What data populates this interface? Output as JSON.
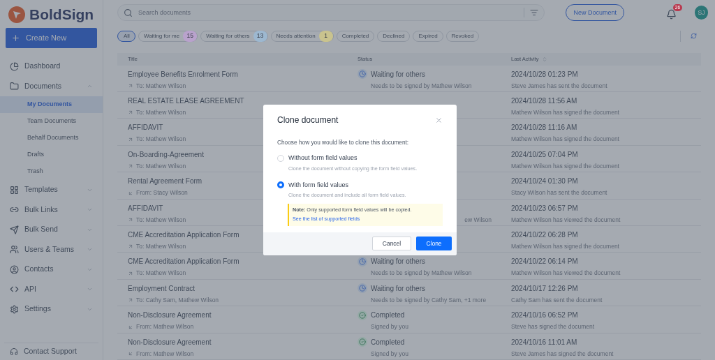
{
  "logo": {
    "text": "BoldSign"
  },
  "create_button": {
    "label": "Create New"
  },
  "sidebar": {
    "items": [
      {
        "label": "Dashboard",
        "has_caret": false,
        "selected": false
      },
      {
        "label": "Documents",
        "expanded": true,
        "has_caret": true,
        "selected": false,
        "children": [
          {
            "label": "My Documents",
            "selected": true
          },
          {
            "label": "Team Documents",
            "selected": false
          },
          {
            "label": "Behalf Documents",
            "selected": false
          },
          {
            "label": "Drafts",
            "selected": false
          },
          {
            "label": "Trash",
            "selected": false
          }
        ]
      },
      {
        "label": "Templates",
        "expanded": false,
        "has_caret": true,
        "selected": false
      },
      {
        "label": "Bulk Links",
        "expanded": false,
        "has_caret": true,
        "selected": false
      },
      {
        "label": "Bulk Send",
        "expanded": false,
        "has_caret": true,
        "selected": false
      },
      {
        "label": "Users & Teams",
        "expanded": false,
        "has_caret": true,
        "selected": false
      },
      {
        "label": "Contacts",
        "expanded": false,
        "has_caret": true,
        "selected": false
      },
      {
        "label": "API",
        "expanded": false,
        "has_caret": true,
        "selected": false
      },
      {
        "label": "Settings",
        "expanded": false,
        "has_caret": true,
        "selected": false
      }
    ],
    "footer": "Contact Support"
  },
  "search": {
    "placeholder": "Search documents"
  },
  "new_document_button": "New Document",
  "notifications": {
    "count": "26"
  },
  "avatar": {
    "initials": "SJ"
  },
  "filters": [
    {
      "label": "All",
      "selected": true
    },
    {
      "label": "Waiting for me",
      "count": "15",
      "color": "#b9a2cc",
      "selected": false
    },
    {
      "label": "Waiting for others",
      "count": "13",
      "color": "#9db8d0",
      "selected": false
    },
    {
      "label": "Needs attention",
      "count": "1",
      "color": "#c9c38e",
      "selected": false
    },
    {
      "label": "Completed",
      "selected": false
    },
    {
      "label": "Declined",
      "selected": false
    },
    {
      "label": "Expired",
      "selected": false
    },
    {
      "label": "Revoked",
      "selected": false
    }
  ],
  "table": {
    "columns": [
      "Title",
      "Status",
      "Last Activity"
    ],
    "rows": [
      {
        "title": "Employee Benefits Enrolment Form",
        "kind": "outgoing",
        "recipients": "To: Mathew Wilson",
        "status": {
          "kind": "waiting",
          "label": "Waiting for others",
          "detail": "Needs to be signed by Mathew Wilson"
        },
        "time": "2024/10/28 01:23 PM",
        "activity": "Steve James has sent the document"
      },
      {
        "title": "REAL ESTATE LEASE AGREEMENT",
        "kind": "outgoing",
        "recipients": "To: Mathew Wilson",
        "time": "2024/10/28 11:56 AM",
        "activity": "Mathew Wilson has signed the document"
      },
      {
        "title": "AFFIDAVIT",
        "kind": "outgoing",
        "recipients": "To: Mathew Wilson",
        "time": "2024/10/28 11:16 AM",
        "activity": "Mathew Wilson has signed the document"
      },
      {
        "title": "On-Boarding-Agreement",
        "kind": "outgoing",
        "recipients": "To: Mathew Wilson",
        "time": "2024/10/25 07:04 PM",
        "activity": "Mathew Wilson has signed the document"
      },
      {
        "title": "Rental Agreement Form",
        "kind": "incoming",
        "recipients": "From: Stacy Wilson",
        "time": "2024/10/24 01:30 PM",
        "activity": "Stacy Wilson has sent the document"
      },
      {
        "title": "AFFIDAVIT",
        "kind": "outgoing",
        "recipients": "To: Mathew Wilson",
        "status": {
          "kind": "clipped",
          "detail": "ew Wilson"
        },
        "time": "2024/10/23 06:57 PM",
        "activity": "Mathew Wilson has viewed the document"
      },
      {
        "title": "CME Accreditation Application Form",
        "kind": "outgoing",
        "recipients": "To: Mathew Wilson",
        "time": "2024/10/22 06:28 PM",
        "activity": "Mathew Wilson has signed the document"
      },
      {
        "title": "CME Accreditation Application Form",
        "kind": "outgoing",
        "recipients": "To: Mathew Wilson",
        "status": {
          "kind": "waiting",
          "label": "Waiting for others",
          "detail": "Needs to be signed by Mathew Wilson"
        },
        "time": "2024/10/22 06:14 PM",
        "activity": "Mathew Wilson has viewed the document"
      },
      {
        "title": "Employment Contract",
        "kind": "outgoing",
        "recipients": "To: Cathy Sam, Mathew Wilson",
        "status": {
          "kind": "waiting",
          "label": "Waiting for others",
          "detail": "Needs to be signed by Cathy Sam, +1 more"
        },
        "time": "2024/10/17 12:26 PM",
        "activity": "Cathy Sam has sent the document"
      },
      {
        "title": "Non-Disclosure Agreement",
        "kind": "incoming",
        "recipients": "From: Mathew Wilson",
        "status": {
          "kind": "completed",
          "label": "Completed",
          "detail": "Signed by you"
        },
        "time": "2024/10/16 06:52 PM",
        "activity": "Steve has signed the document"
      },
      {
        "title": "Non-Disclosure Agreement",
        "kind": "incoming",
        "recipients": "From: Mathew Wilson",
        "status": {
          "kind": "completed",
          "label": "Completed",
          "detail": "Signed by you"
        },
        "time": "2024/10/16 11:01 AM",
        "activity": "Steve James has signed the document"
      }
    ]
  },
  "dialog": {
    "title": "Clone document",
    "prompt": "Choose how you would like to clone this document:",
    "options": [
      {
        "label": "Without form field values",
        "description": "Clone the document without copying the form field values.",
        "selected": false
      },
      {
        "label": "With form field values",
        "description": "Clone the document and include all form field values.",
        "selected": true
      }
    ],
    "note": "**Note:** Only supported form field values will be copied.",
    "note_link": "See the list of supported fields",
    "buttons": [
      {
        "label": "Cancel",
        "kind": "secondary"
      },
      {
        "label": "Clone",
        "kind": "primary"
      }
    ]
  }
}
